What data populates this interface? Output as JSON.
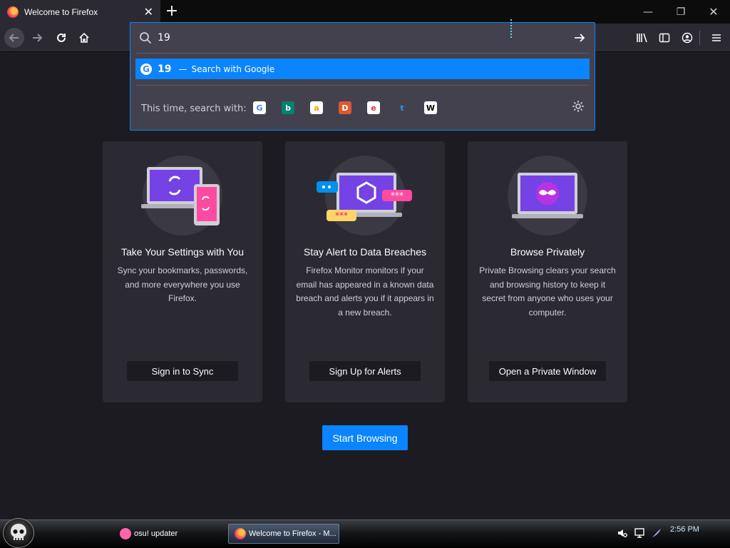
{
  "tab": {
    "title": "Welcome to Firefox",
    "close_label": "✕",
    "new_tab_label": "+"
  },
  "window_controls": {
    "minimize": "—",
    "restore": "❐",
    "close": "✕"
  },
  "urlbar": {
    "typed_text": "19",
    "result": {
      "query": "19",
      "dash": "—",
      "action": "Search with Google"
    },
    "one_off_label": "This time, search with:",
    "engines": [
      {
        "name": "google-engine-icon",
        "glyph": "G",
        "color": "#4285f4",
        "bg": "#ffffff"
      },
      {
        "name": "bing-engine-icon",
        "glyph": "b",
        "color": "#ffffff",
        "bg": "#008373"
      },
      {
        "name": "amazon-engine-icon",
        "glyph": "a",
        "color": "#ff9900",
        "bg": "#ffffff"
      },
      {
        "name": "duckduckgo-engine-icon",
        "glyph": "D",
        "color": "#ffffff",
        "bg": "#de5833"
      },
      {
        "name": "ebay-engine-icon",
        "glyph": "e",
        "color": "#e53238",
        "bg": "#ffffff"
      },
      {
        "name": "twitter-engine-icon",
        "glyph": "t",
        "color": "#1da1f2",
        "bg": "#42414d"
      },
      {
        "name": "wikipedia-engine-icon",
        "glyph": "W",
        "color": "#000000",
        "bg": "#ffffff"
      }
    ]
  },
  "cards": [
    {
      "title": "Take Your Settings with You",
      "body": "Sync your bookmarks, passwords, and more everywhere you use Firefox.",
      "button": "Sign in to Sync"
    },
    {
      "title": "Stay Alert to Data Breaches",
      "body": "Firefox Monitor monitors if your email has appeared in a known data breach and alerts you if it appears in a new breach.",
      "button": "Sign Up for Alerts"
    },
    {
      "title": "Browse Privately",
      "body": "Private Browsing clears your search and browsing history to keep it secret from anyone who uses your computer.",
      "button": "Open a Private Window"
    }
  ],
  "start_button": "Start Browsing",
  "taskbar": {
    "tasks": [
      {
        "label": "osu! updater"
      },
      {
        "label": "Welcome to Firefox - M..."
      }
    ],
    "clock": "2:56 PM"
  }
}
